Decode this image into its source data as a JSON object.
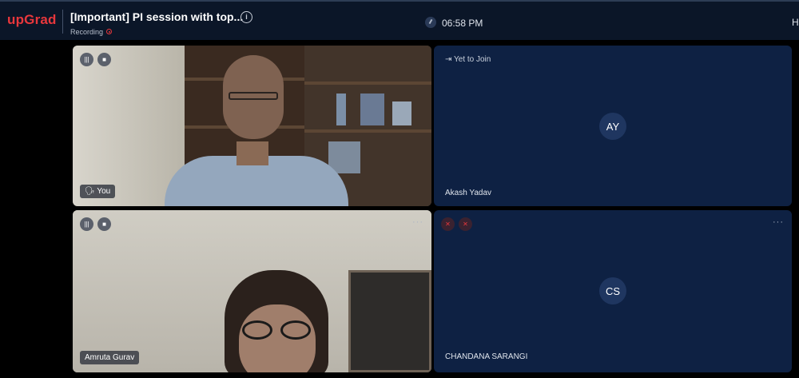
{
  "header": {
    "logo": "upGrad",
    "session_title": "[Important] PI session with top...",
    "info_icon": "info-icon",
    "recording_label": "Recording",
    "time": "06:58 PM",
    "right_label": "H",
    "colors": {
      "brand": "#e8373c",
      "bar": "#0b1628"
    }
  },
  "tiles": {
    "you": {
      "name": "You",
      "icons": [
        "mic-bars-icon",
        "camera-icon"
      ]
    },
    "akash": {
      "status": "Yet to Join",
      "initials": "AY",
      "name": "Akash Yadav"
    },
    "amruta": {
      "name": "Amruta Gurav",
      "more": "···",
      "icons": [
        "mic-bars-icon",
        "camera-icon"
      ]
    },
    "chandana": {
      "initials": "CS",
      "name": "CHANDANA SARANGI",
      "more": "···",
      "icons": [
        "mic-off-icon",
        "camera-off-icon"
      ]
    }
  }
}
